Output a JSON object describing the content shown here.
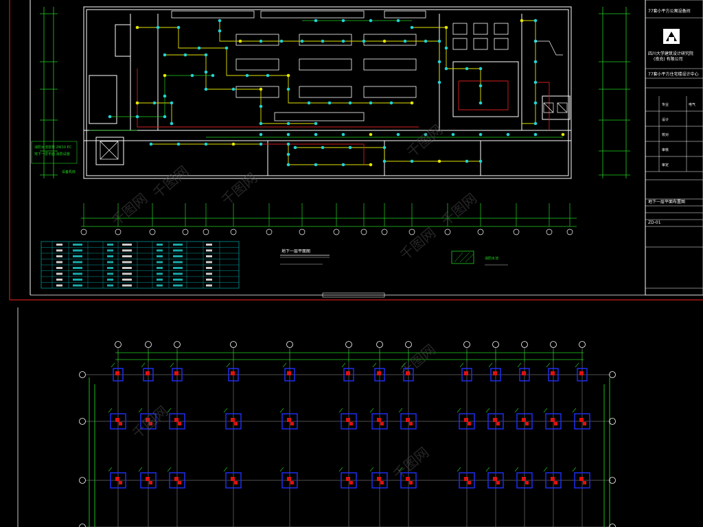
{
  "drawing_title": "地下一层平面图",
  "notes": {
    "left_note_1": "消防水池容量 2W10 EC",
    "left_note_2": "地下一层平面 消防设施",
    "left_note_3": "设备机房"
  },
  "title_block": {
    "project_header": "77套小平方公寓设备间",
    "company_name_1": "四川大学建筑设计研究院",
    "company_name_2": "(南充) 有限公司",
    "project_name": "77套小平方住宅楼设计中心",
    "rows": [
      {
        "label": "专业",
        "value": "电气"
      },
      {
        "label": "设计",
        "value": ""
      },
      {
        "label": "校对",
        "value": ""
      },
      {
        "label": "审核",
        "value": ""
      },
      {
        "label": "审定",
        "value": ""
      }
    ],
    "sheet_title": "地下一层平面布置图",
    "sheet_no": "ZD-01"
  },
  "legend_label": "消防水池",
  "watermark": "千图网",
  "colors": {
    "background": "#000000",
    "wall": "#ffffff",
    "grid_green": "#21d321",
    "cable_yellow": "#e6e600",
    "cable_red": "#d42020",
    "fixture_cyan": "#21d3d3",
    "column_blue": "#2030ff",
    "column_red": "#e01010",
    "table_cyan": "#00c8c8",
    "border_red": "#c81e1e"
  }
}
